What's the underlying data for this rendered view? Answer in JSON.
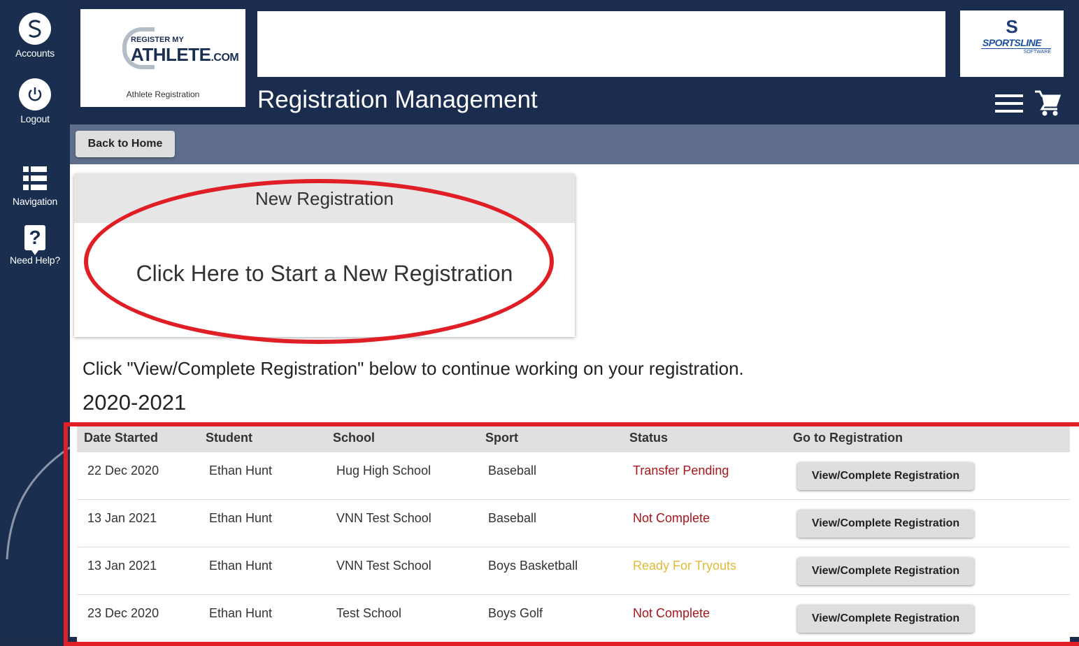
{
  "sidebar": {
    "accounts_label": "Accounts",
    "logout_label": "Logout",
    "navigation_label": "Navigation",
    "help_label": "Need Help?"
  },
  "header": {
    "logo_small": "REGISTER MY",
    "logo_big": "ATHLETE",
    "logo_suffix": ".COM",
    "logo_caption": "Athlete Registration",
    "partner_brand": "SPORTSLINE",
    "partner_sub": "SOFTWARE",
    "title": "Registration Management"
  },
  "toolbar": {
    "back_label": "Back to Home"
  },
  "new_registration": {
    "heading": "New Registration",
    "link_text": "Click Here to Start a New Registration"
  },
  "instruction": "Click \"View/Complete Registration\" below to continue working on your registration.",
  "season": "2020-2021",
  "table": {
    "columns": [
      "Date Started",
      "Student",
      "School",
      "Sport",
      "Status",
      "Go to Registration"
    ],
    "button_label": "View/Complete Registration",
    "rows": [
      {
        "date": "22 Dec 2020",
        "student": "Ethan Hunt",
        "school": "Hug High School",
        "sport": "Baseball",
        "status": "Transfer Pending",
        "status_color": "#a8161c"
      },
      {
        "date": "13 Jan 2021",
        "student": "Ethan Hunt",
        "school": "VNN Test School",
        "sport": "Baseball",
        "status": "Not Complete",
        "status_color": "#a8161c"
      },
      {
        "date": "13 Jan 2021",
        "student": "Ethan Hunt",
        "school": "VNN Test School",
        "sport": "Boys Basketball",
        "status": "Ready For Tryouts",
        "status_color": "#e0bb3a"
      },
      {
        "date": "23 Dec 2020",
        "student": "Ethan Hunt",
        "school": "Test School",
        "sport": "Boys Golf",
        "status": "Not Complete",
        "status_color": "#a8161c"
      }
    ]
  },
  "colors": {
    "navy": "#1b2d4f",
    "toolbar": "#5d6d8a",
    "highlight_red": "#e01e25"
  }
}
